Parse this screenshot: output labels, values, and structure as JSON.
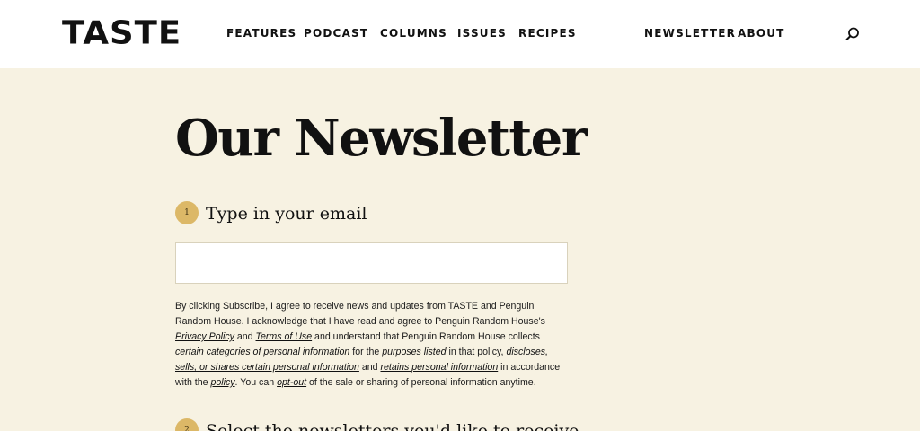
{
  "header": {
    "logo": "TASTE",
    "nav_left": [
      "FEATURES",
      "PODCAST",
      "COLUMNS",
      "ISSUES",
      "RECIPES"
    ],
    "nav_right": [
      "NEWSLETTER",
      "ABOUT"
    ],
    "search_icon": "search-icon"
  },
  "main": {
    "title": "Our Newsletter",
    "step1": {
      "number": "1",
      "label": "Type in your email"
    },
    "email": {
      "value": "",
      "placeholder": ""
    },
    "legal": {
      "t1": "By clicking Subscribe, I agree to receive news and updates from TASTE and Penguin Random House. I acknowledge that I have read and agree to Penguin Random House's ",
      "privacy_policy": "Privacy Policy",
      "t2": " and ",
      "terms_of_use": "Terms of Use",
      "t3": " and understand that Penguin Random House collects ",
      "certain_categories": "certain categories of personal information",
      "t4": " for the ",
      "purposes_listed": "purposes listed",
      "t5": " in that policy, ",
      "discloses": "discloses, sells, or shares certain personal information",
      "t6": " and ",
      "retains": "retains personal information",
      "t7": " in accordance with the ",
      "policy": "policy",
      "t8": ". You can ",
      "opt_out": "opt-out",
      "t9": " of the sale or sharing of personal information anytime."
    },
    "step2": {
      "number": "2",
      "label": "Select the newsletters you'd like to receive"
    }
  },
  "colors": {
    "background": "#f7f2e2",
    "header": "#ffffff",
    "accent": "#dcb867",
    "text": "#111111"
  }
}
